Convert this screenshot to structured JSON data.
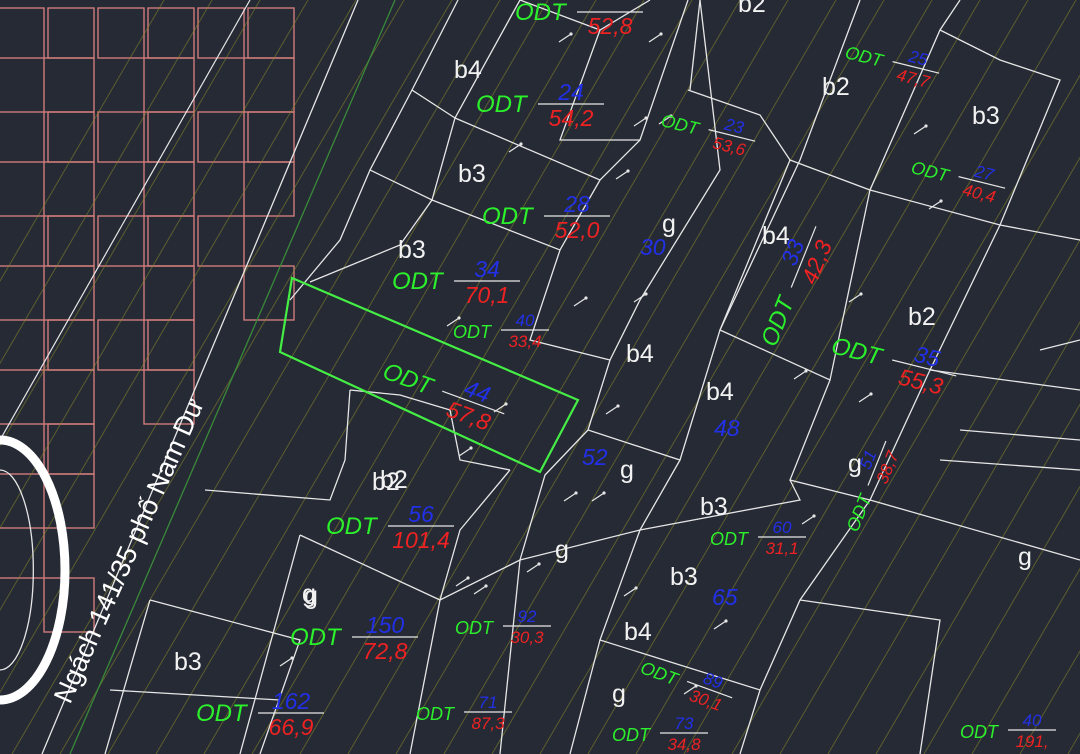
{
  "road_label": "Ngách 141/35 phố Nam Dư",
  "land_code": "ODT",
  "colors": {
    "background": "#252a34",
    "land_code": "#2cf02c",
    "parcel_number": "#2230e8",
    "parcel_area": "#ee2222",
    "boundary": "#e6e6e6",
    "highlight": "#45ee45",
    "building": "#d07a7a"
  },
  "parcels": [
    {
      "code": "ODT",
      "number": "",
      "area": "52,8"
    },
    {
      "code": "ODT",
      "number": "24",
      "area": "54,2"
    },
    {
      "code": "ODT",
      "number": "23",
      "area": "53,6"
    },
    {
      "code": "ODT",
      "number": "25",
      "area": "47,7"
    },
    {
      "code": "ODT",
      "number": "27",
      "area": "40,4"
    },
    {
      "code": "ODT",
      "number": "28",
      "area": "52,0"
    },
    {
      "code": "ODT",
      "number": "34",
      "area": "70,1"
    },
    {
      "code": "ODT",
      "number": "40",
      "area": "33,4"
    },
    {
      "code": "ODT",
      "number": "44",
      "area": "57,8",
      "highlighted": true
    },
    {
      "code": "ODT",
      "number": "33",
      "area": "42,3"
    },
    {
      "code": "ODT",
      "number": "35",
      "area": "55,3"
    },
    {
      "code": "ODT",
      "number": "51",
      "area": "38,7"
    },
    {
      "code": "ODT",
      "number": "56",
      "area": "101,4"
    },
    {
      "code": "ODT",
      "number": "60",
      "area": "31,1"
    },
    {
      "code": "ODT",
      "number": "150",
      "area": "72,8"
    },
    {
      "code": "ODT",
      "number": "92",
      "area": "30,3"
    },
    {
      "code": "ODT",
      "number": "162",
      "area": "66,9"
    },
    {
      "code": "ODT",
      "number": "71",
      "area": "87,3"
    },
    {
      "code": "ODT",
      "number": "73",
      "area": "34,8"
    },
    {
      "code": "ODT",
      "number": "89",
      "area": "30,1"
    },
    {
      "code": "ODT",
      "number": "40",
      "area": "191,"
    }
  ],
  "parcel_numbers_only": [
    "30",
    "52",
    "48",
    "65"
  ],
  "zone_labels": [
    "b2",
    "b4",
    "b3",
    "b3",
    "b2",
    "b3",
    "b4",
    "b2",
    "b4",
    "b4",
    "b2",
    "g",
    "g",
    "g",
    "g",
    "b3",
    "b3",
    "b2",
    "g",
    "g",
    "b4",
    "b3",
    "g",
    "g"
  ]
}
